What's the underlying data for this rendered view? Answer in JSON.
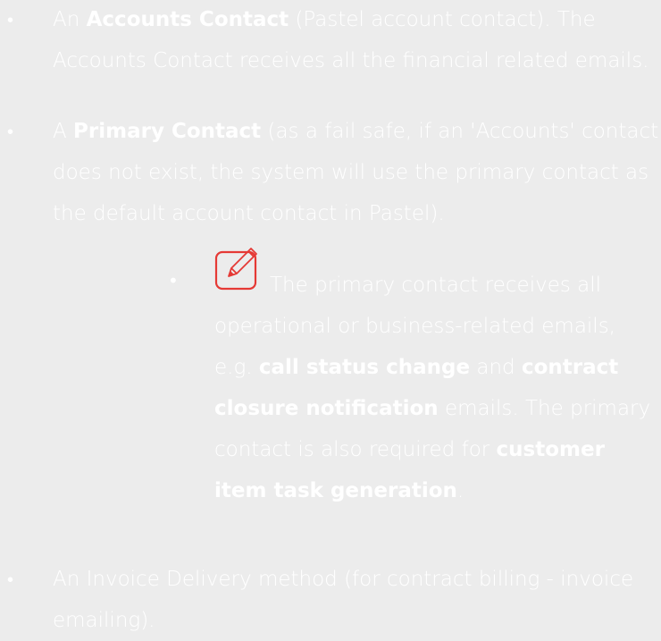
{
  "items": [
    {
      "pre": "An ",
      "bold": "Accounts Contact",
      "post": " (Pastel account contact). The Accounts Contact receives all the financial related emails."
    },
    {
      "pre": "A ",
      "bold": "Primary Contact",
      "post": " (as a fail safe, if an 'Accounts' contact does not exist, the system will use the primary contact as the default account contact in Pastel)."
    },
    {
      "text": "An Invoice Delivery method (for contract billing - invoice emailing)."
    }
  ],
  "bullet_char": "•",
  "note": {
    "icon": "edit-note-icon",
    "icon_color": "#e53935",
    "t1": "The primary contact receives all operational or business-related emails, e.g. ",
    "b1": "call status change",
    "t2": " and ",
    "b2": "contract closure notification",
    "t3": " emails. The primary contact is also required for ",
    "b3": "customer item task generation",
    "t4": "."
  }
}
